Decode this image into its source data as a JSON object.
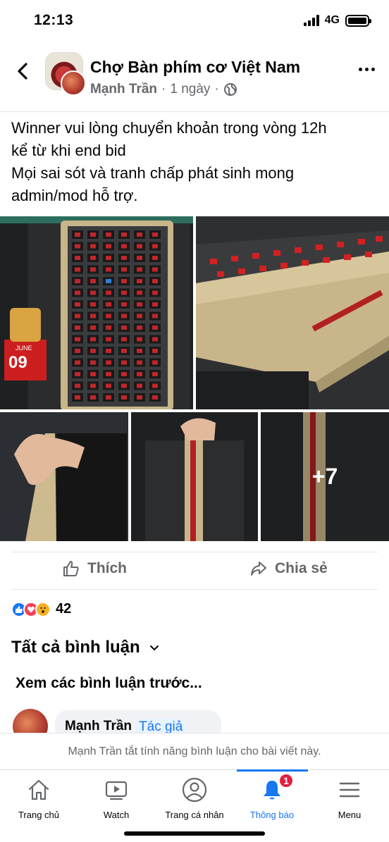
{
  "status_bar": {
    "time": "12:13",
    "network": "4G"
  },
  "header": {
    "group_name": "Chợ Bàn phím cơ Việt Nam",
    "author": "Mạnh Trần",
    "time_ago": "1 ngày",
    "separator": "·"
  },
  "post": {
    "lines": [
      "Winner vui lòng chuyển khoản trong vòng 12h",
      "kể từ khi end bid",
      "Mọi sai sót và tranh chấp phát sinh mong",
      "admin/mod hỗ trợ."
    ],
    "more_photos": "+7",
    "calendar_month": "JUNE",
    "calendar_day": "09"
  },
  "actions": {
    "like": "Thích",
    "share": "Chia sẻ"
  },
  "reactions": {
    "count": "42"
  },
  "comments": {
    "all_comments": "Tất cả bình luận",
    "view_previous": "Xem các bình luận trước...",
    "first_author": "Mạnh Trần",
    "author_badge": "Tác giả",
    "disabled_notice": "Mạnh Trần tắt tính năng bình luận cho bài viết này."
  },
  "nav": {
    "items": [
      {
        "label": "Trang chủ"
      },
      {
        "label": "Watch"
      },
      {
        "label": "Trang cá nhân"
      },
      {
        "label": "Thông báo",
        "badge": "1"
      },
      {
        "label": "Menu"
      }
    ]
  }
}
